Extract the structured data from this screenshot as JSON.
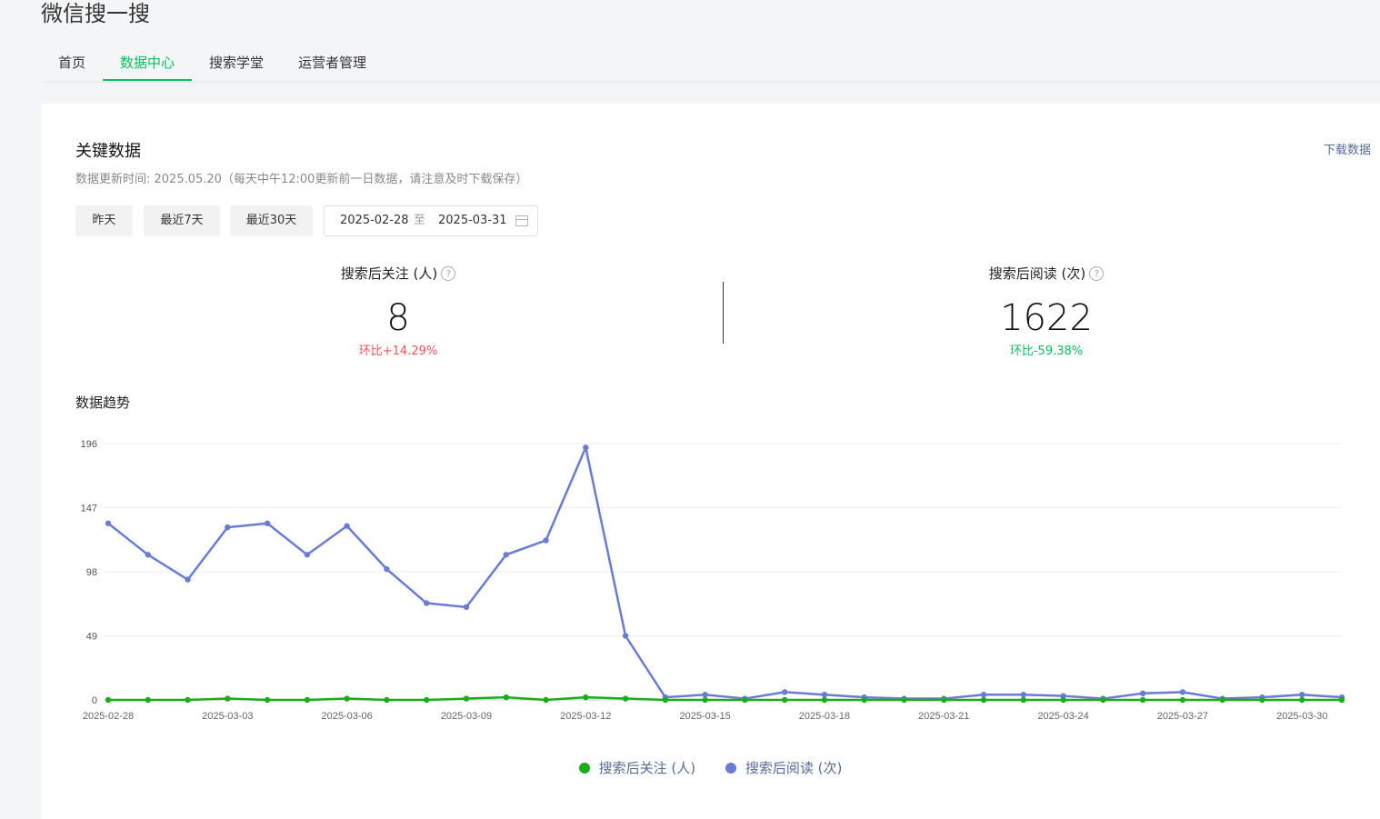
{
  "app": {
    "title": "微信搜一搜"
  },
  "nav": {
    "tabs": [
      "首页",
      "数据中心",
      "搜索学堂",
      "运营者管理"
    ],
    "active": 1
  },
  "key_data": {
    "title": "关键数据",
    "download_label": "下载数据",
    "update_note": "数据更新时间: 2025.05.20（每天中午12:00更新前一日数据，请注意及时下载保存）",
    "ranges": [
      "昨天",
      "最近7天",
      "最近30天"
    ],
    "date_start": "2025-02-28",
    "date_sep": "至",
    "date_end": "2025-03-31"
  },
  "kpis": [
    {
      "label": "搜索后关注 (人)",
      "value": "8",
      "change": "环比+14.29%",
      "change_color": "#fa5151"
    },
    {
      "label": "搜索后阅读 (次)",
      "value": "1622",
      "change": "环比-59.38%",
      "change_color": "#07c160"
    }
  ],
  "trend": {
    "title": "数据趋势"
  },
  "colors": {
    "accent": "#07c160",
    "follow": "#1aad19",
    "read": "#6a7bd6"
  },
  "chart_data": {
    "type": "line",
    "x": [
      "2025-02-28",
      "2025-03-01",
      "2025-03-02",
      "2025-03-03",
      "2025-03-04",
      "2025-03-05",
      "2025-03-06",
      "2025-03-07",
      "2025-03-08",
      "2025-03-09",
      "2025-03-10",
      "2025-03-11",
      "2025-03-12",
      "2025-03-13",
      "2025-03-14",
      "2025-03-15",
      "2025-03-16",
      "2025-03-17",
      "2025-03-18",
      "2025-03-19",
      "2025-03-20",
      "2025-03-21",
      "2025-03-22",
      "2025-03-23",
      "2025-03-24",
      "2025-03-25",
      "2025-03-26",
      "2025-03-27",
      "2025-03-28",
      "2025-03-29",
      "2025-03-30",
      "2025-03-31"
    ],
    "x_tick_labels": [
      "2025-02-28",
      "2025-03-03",
      "2025-03-06",
      "2025-03-09",
      "2025-03-12",
      "2025-03-15",
      "2025-03-18",
      "2025-03-21",
      "2025-03-24",
      "2025-03-27",
      "2025-03-30"
    ],
    "y_ticks": [
      0,
      49,
      98,
      147,
      196
    ],
    "ylim": [
      0,
      196
    ],
    "grid": true,
    "legend_position": "bottom-center",
    "series": [
      {
        "name": "搜索后关注 (人)",
        "values": [
          0,
          0,
          0,
          1,
          0,
          0,
          1,
          0,
          0,
          1,
          2,
          0,
          2,
          1,
          0,
          0,
          0,
          0,
          0,
          0,
          0,
          0,
          0,
          0,
          0,
          0,
          0,
          0,
          0,
          0,
          0,
          0
        ]
      },
      {
        "name": "搜索后阅读 (次)",
        "values": [
          135,
          111,
          92,
          132,
          135,
          111,
          133,
          100,
          74,
          71,
          111,
          122,
          193,
          49,
          2,
          4,
          1,
          6,
          4,
          2,
          1,
          1,
          4,
          4,
          3,
          1,
          5,
          6,
          1,
          2,
          4,
          2
        ]
      }
    ]
  }
}
